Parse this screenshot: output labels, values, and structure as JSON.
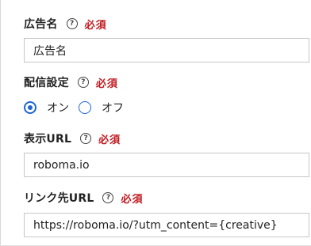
{
  "fields": {
    "ad_name": {
      "label": "広告名",
      "required_badge": "必須",
      "value": "広告名"
    },
    "delivery": {
      "label": "配信設定",
      "required_badge": "必須",
      "options": [
        "オン",
        "オフ"
      ],
      "selected": "オン"
    },
    "display_url": {
      "label": "表示URL",
      "required_badge": "必須",
      "value": "roboma.io"
    },
    "link_url": {
      "label": "リンク先URL",
      "required_badge": "必須",
      "value": "https://roboma.io/?utm_content={creative}"
    }
  },
  "help_glyph": "?",
  "icons": {
    "help": "help-circle-icon"
  },
  "colors": {
    "required": "#c0191f",
    "radio_accent": "#1f66d1",
    "input_border": "#c7c7c7",
    "text": "#222222"
  }
}
